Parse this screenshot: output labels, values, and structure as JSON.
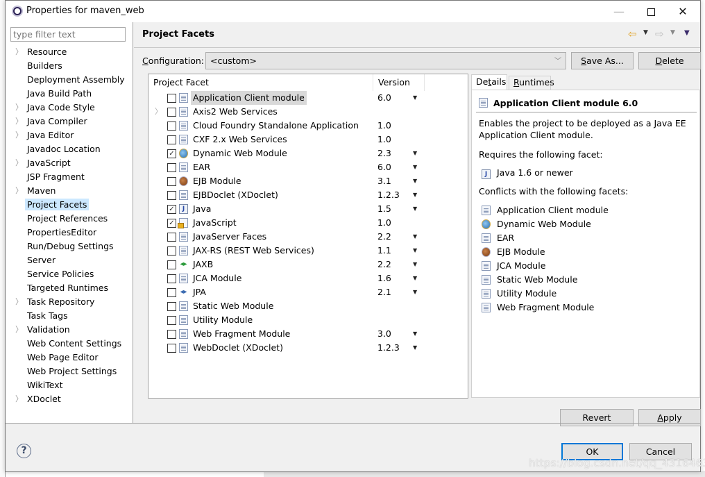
{
  "window": {
    "title": "Properties for maven_web",
    "minimize_label": "—",
    "close_label": "✕"
  },
  "sidebar": {
    "filter_placeholder": "type filter text",
    "items": [
      {
        "label": "Resource",
        "expandable": true
      },
      {
        "label": "Builders",
        "expandable": false
      },
      {
        "label": "Deployment Assembly",
        "expandable": false
      },
      {
        "label": "Java Build Path",
        "expandable": false
      },
      {
        "label": "Java Code Style",
        "expandable": true
      },
      {
        "label": "Java Compiler",
        "expandable": true
      },
      {
        "label": "Java Editor",
        "expandable": true
      },
      {
        "label": "Javadoc Location",
        "expandable": false
      },
      {
        "label": "JavaScript",
        "expandable": true
      },
      {
        "label": "JSP Fragment",
        "expandable": false
      },
      {
        "label": "Maven",
        "expandable": true
      },
      {
        "label": "Project Facets",
        "expandable": false,
        "selected": true
      },
      {
        "label": "Project References",
        "expandable": false
      },
      {
        "label": "PropertiesEditor",
        "expandable": false
      },
      {
        "label": "Run/Debug Settings",
        "expandable": false
      },
      {
        "label": "Server",
        "expandable": false
      },
      {
        "label": "Service Policies",
        "expandable": false
      },
      {
        "label": "Targeted Runtimes",
        "expandable": false
      },
      {
        "label": "Task Repository",
        "expandable": true
      },
      {
        "label": "Task Tags",
        "expandable": false
      },
      {
        "label": "Validation",
        "expandable": true
      },
      {
        "label": "Web Content Settings",
        "expandable": false
      },
      {
        "label": "Web Page Editor",
        "expandable": false
      },
      {
        "label": "Web Project Settings",
        "expandable": false
      },
      {
        "label": "WikiText",
        "expandable": false
      },
      {
        "label": "XDoclet",
        "expandable": true
      }
    ]
  },
  "page": {
    "title": "Project Facets",
    "configuration_label_mnemonic": "C",
    "configuration_label_rest": "onfiguration:",
    "configuration_value": "<custom>",
    "save_as_mnemonic": "S",
    "save_as_rest": "ave As...",
    "delete_mnemonic": "D",
    "delete_rest": "elete"
  },
  "facet_table": {
    "columns": [
      "Project Facet",
      "Version"
    ],
    "rows": [
      {
        "name": "Application Client module",
        "version": "6.0",
        "checked": false,
        "dropdown": true,
        "icon": "doc",
        "selected": true
      },
      {
        "name": "Axis2 Web Services",
        "version": "",
        "checked": false,
        "dropdown": false,
        "icon": "doc",
        "expandable": true
      },
      {
        "name": "Cloud Foundry Standalone Application",
        "version": "1.0",
        "checked": false,
        "dropdown": false,
        "icon": "doc"
      },
      {
        "name": "CXF 2.x Web Services",
        "version": "1.0",
        "checked": false,
        "dropdown": false,
        "icon": "doc"
      },
      {
        "name": "Dynamic Web Module",
        "version": "2.3",
        "checked": true,
        "dropdown": true,
        "icon": "globe"
      },
      {
        "name": "EAR",
        "version": "6.0",
        "checked": false,
        "dropdown": true,
        "icon": "doc"
      },
      {
        "name": "EJB Module",
        "version": "3.1",
        "checked": false,
        "dropdown": true,
        "icon": "bean"
      },
      {
        "name": "EJBDoclet (XDoclet)",
        "version": "1.2.3",
        "checked": false,
        "dropdown": true,
        "icon": "doc"
      },
      {
        "name": "Java",
        "version": "1.5",
        "checked": true,
        "dropdown": true,
        "icon": "java"
      },
      {
        "name": "JavaScript",
        "version": "1.0",
        "checked": true,
        "dropdown": false,
        "icon": "lockdoc"
      },
      {
        "name": "JavaServer Faces",
        "version": "2.2",
        "checked": false,
        "dropdown": true,
        "icon": "doc"
      },
      {
        "name": "JAX-RS (REST Web Services)",
        "version": "1.1",
        "checked": false,
        "dropdown": true,
        "icon": "doc"
      },
      {
        "name": "JAXB",
        "version": "2.2",
        "checked": false,
        "dropdown": true,
        "icon": "arrows"
      },
      {
        "name": "JCA Module",
        "version": "1.6",
        "checked": false,
        "dropdown": true,
        "icon": "doc"
      },
      {
        "name": "JPA",
        "version": "2.1",
        "checked": false,
        "dropdown": true,
        "icon": "arrows-jpa"
      },
      {
        "name": "Static Web Module",
        "version": "",
        "checked": false,
        "dropdown": false,
        "icon": "doc"
      },
      {
        "name": "Utility Module",
        "version": "",
        "checked": false,
        "dropdown": false,
        "icon": "doc"
      },
      {
        "name": "Web Fragment Module",
        "version": "3.0",
        "checked": false,
        "dropdown": true,
        "icon": "doc"
      },
      {
        "name": "WebDoclet (XDoclet)",
        "version": "1.2.3",
        "checked": false,
        "dropdown": true,
        "icon": "doc"
      }
    ]
  },
  "details": {
    "tabs": [
      {
        "label_pre": "De",
        "mnemonic": "t",
        "label_post": "ails",
        "active": true
      },
      {
        "label_pre": "",
        "mnemonic": "R",
        "label_post": "untimes",
        "active": false
      }
    ],
    "title": "Application Client module 6.0",
    "description": "Enables the project to be deployed as a Java EE Application Client module.",
    "requires_label": "Requires the following facet:",
    "requires": [
      {
        "label": "Java 1.6 or newer",
        "icon": "java"
      }
    ],
    "conflicts_label": "Conflicts with the following facets:",
    "conflicts": [
      {
        "label": "Application Client module",
        "icon": "doc"
      },
      {
        "label": "Dynamic Web Module",
        "icon": "globe"
      },
      {
        "label": "EAR",
        "icon": "doc"
      },
      {
        "label": "EJB Module",
        "icon": "bean"
      },
      {
        "label": "JCA Module",
        "icon": "doc"
      },
      {
        "label": "Static Web Module",
        "icon": "doc"
      },
      {
        "label": "Utility Module",
        "icon": "doc"
      },
      {
        "label": "Web Fragment Module",
        "icon": "doc"
      }
    ]
  },
  "buttons": {
    "revert": "Revert",
    "apply_mnemonic": "A",
    "apply_rest": "pply",
    "ok": "OK",
    "cancel": "Cancel",
    "help": "?"
  },
  "watermark": "https://blog.csdn.net/qq_43164639",
  "colors": {
    "selection_blue": "#cce8ff",
    "default_button_border": "#0078d7",
    "dialog_bg": "#f0f0f0"
  }
}
